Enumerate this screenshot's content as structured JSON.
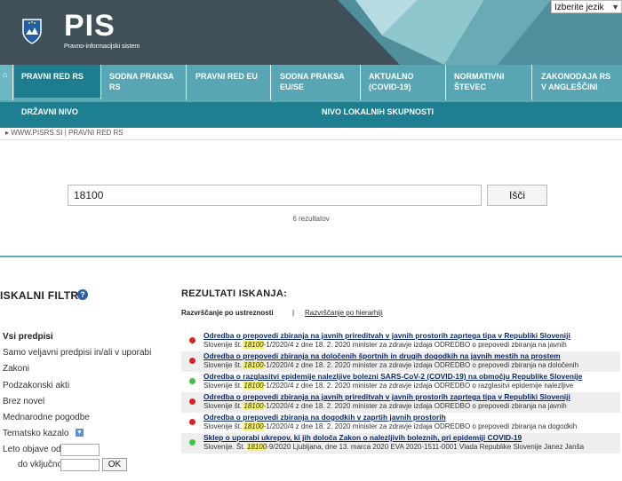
{
  "header": {
    "logo": "PIS",
    "subtitle": "Pravno-informacijski sistem",
    "language_select": "Izberite jezik"
  },
  "nav": {
    "home_icon": "home-icon",
    "primary": [
      {
        "label": "PRAVNI RED RS",
        "active": true
      },
      {
        "label": "SODNA PRAKSA RS",
        "active": false
      },
      {
        "label": "PRAVNI RED EU",
        "active": false
      },
      {
        "label": "SODNA PRAKSA EU/SE",
        "active": false
      },
      {
        "label": "AKTUALNO (COVID-19)",
        "active": false
      },
      {
        "label": "NORMATIVNI ŠTEVEC",
        "active": false
      },
      {
        "label": "ZAKONODAJA RS V ANGLEŠČINI",
        "active": false
      }
    ],
    "secondary": [
      {
        "label": "DRŽAVNI NIVO"
      },
      {
        "label": "NIVO LOKALNIH SKUPNOSTI"
      }
    ]
  },
  "breadcrumb": "WWW.PISRS.SI | PRAVNI RED RS",
  "search": {
    "value": "18100",
    "button": "Išči",
    "result_count": "6 rezultatov"
  },
  "filters": {
    "title": "ISKALNI FILTRI",
    "items": [
      {
        "label": "Vsi predpisi",
        "bold": true
      },
      {
        "label": "Samo veljavni predpisi in/ali v uporabi",
        "bold": false
      },
      {
        "label": "Zakoni",
        "bold": false
      },
      {
        "label": "Podzakonski akti",
        "bold": false
      },
      {
        "label": "Brez novel",
        "bold": false
      },
      {
        "label": "Mednarodne pogodbe",
        "bold": false
      },
      {
        "label": "Tematsko kazalo",
        "bold": false
      }
    ],
    "date_from_label": "Leto objave od",
    "date_to_label": "do vključno",
    "ok": "OK"
  },
  "results": {
    "title": "REZULTATI ISKANJA:",
    "sort_relevance": "Razvrščanje po ustreznosti",
    "sort_separator": "|",
    "sort_hierarchy": "Razvrščanje po hierarhiji",
    "items": [
      {
        "title": "Odredba o prepovedi zbiranja na javnih prireditvah v javnih prostorih zaprtega tipa v Republiki Sloveniji",
        "pre": "Slovenije št. ",
        "hl": "18100",
        "post": "-1/2020/4 z dne 18. 2. 2020 minister za zdravje izdaja ODREDBO o prepovedi zbiranja na javnih",
        "status": "red",
        "status_color": "#e02020"
      },
      {
        "title": "Odredba o prepovedi zbiranja na določenih športnih in drugih dogodkih na javnih mestih na prostem",
        "pre": "Slovenije št. ",
        "hl": "18100",
        "post": "-1/2020/4 z dne 18. 2. 2020 minister za zdravje izdaja ODREDBO o prepovedi zbiranja na določenih",
        "status": "red",
        "status_color": "#e02020"
      },
      {
        "title": "Odredba o razglasitvi epidemije nalezljive bolezni SARS-CoV-2 (COVID-19) na območju Republike Slovenije",
        "pre": "Slovenije št. ",
        "hl": "18100",
        "post": "-1/2020/4 z dne 18. 2. 2020 minister za zdravje izdaja ODREDBO o razglasitvi epidemije nalezljive",
        "status": "green",
        "status_color": "#3cc83c"
      },
      {
        "title": "Odredba o prepovedi zbiranja na javnih prireditvah v javnih prostorih zaprtega tipa v Republiki Sloveniji",
        "pre": "Slovenije št. ",
        "hl": "18100",
        "post": "-1/2020/4 z dne 18. 2. 2020 minister za zdravje izdaja ODREDBO o prepovedi zbiranja na javnih",
        "status": "red",
        "status_color": "#e02020"
      },
      {
        "title": "Odredba o prepovedi zbiranja na dogodkih v zaprtih javnih prostorih",
        "pre": "Slovenije št. ",
        "hl": "18100",
        "post": "-1/2020/4 z dne 18. 2. 2020 minister za zdravje izdaja ODREDBO o prepovedi zbiranja na dogodkih",
        "status": "red",
        "status_color": "#e02020"
      },
      {
        "title": "Sklep o uporabi ukrepov, ki jih določa Zakon o nalezljivih boleznih, pri epidemiji COVID-19",
        "pre": "Slovenije. Št. ",
        "hl": "18100",
        "post": "-9/2020 Ljubljana, dne 13. marca 2020 EVA 2020-1511-0001 Vlada Republike Slovenije Janez Janša",
        "status": "green",
        "status_color": "#3cc83c"
      }
    ]
  },
  "colors": {
    "header_bg": "#3d4e57",
    "nav_primary": "#5aa9b6",
    "nav_active": "#1d7c8d",
    "nav_secondary": "#1d7f90",
    "link": "#0b2a6e",
    "highlight": "#f4f065"
  }
}
